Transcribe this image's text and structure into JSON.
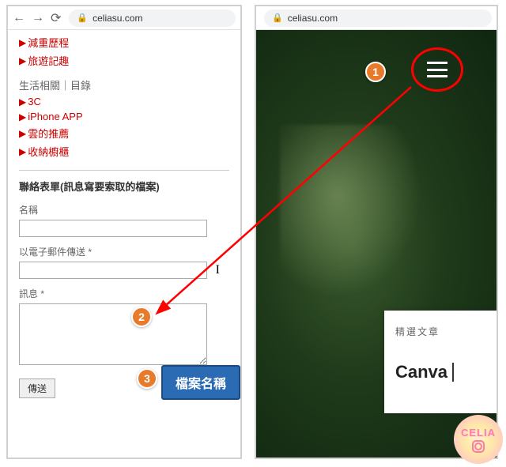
{
  "browser": {
    "domain": "celiasu.com"
  },
  "left": {
    "links_a": [
      "減重歷程",
      "旅遊記趣"
    ],
    "section_b_title": "生活相關｜目錄",
    "links_b": [
      "3C",
      "iPhone APP",
      "雲的推薦",
      "收納櫥櫃"
    ],
    "form": {
      "title": "聯絡表單(訊息寫要索取的檔案)",
      "name_label": "名稱",
      "email_label": "以電子郵件傳送 *",
      "message_label": "訊息 *",
      "submit_label": "傳送"
    }
  },
  "right": {
    "card_head": "精選文章",
    "card_body": "Canva"
  },
  "annotations": {
    "badge1": "1",
    "badge2": "2",
    "badge3": "3",
    "callout": "檔案名稱"
  },
  "logo": {
    "text": "CELIA"
  }
}
